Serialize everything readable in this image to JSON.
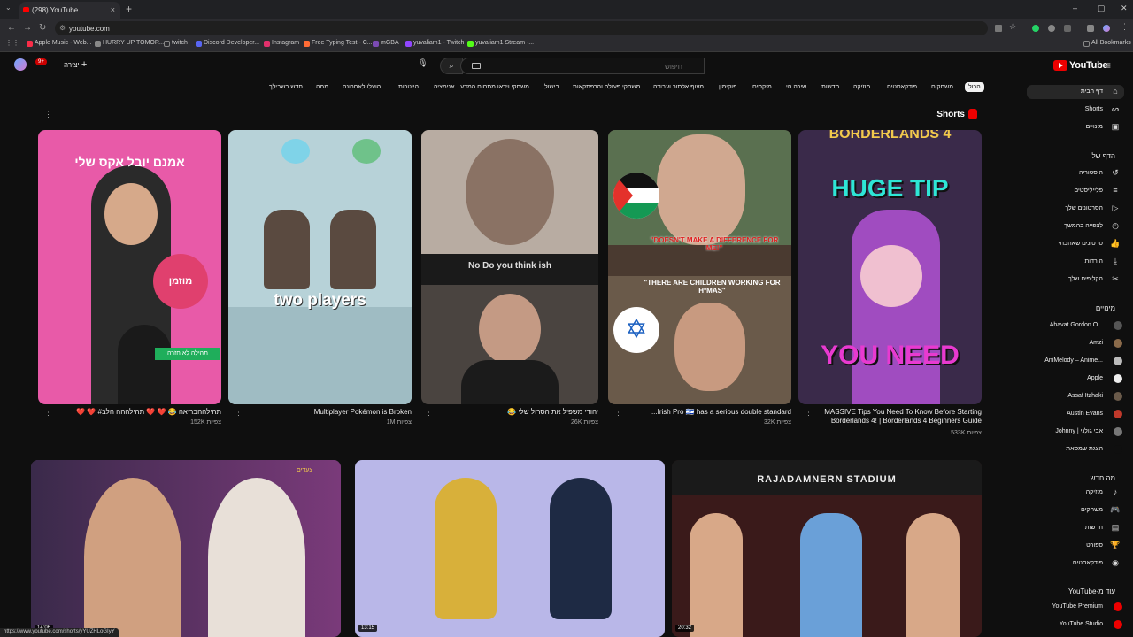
{
  "browser": {
    "tab_title": "(298) YouTube",
    "url": "youtube.com",
    "bookmarks": [
      {
        "label": "Apple Music - Web...",
        "color": "#fa2d48"
      },
      {
        "label": "HURRY UP TOMOR...",
        "color": "#888888"
      },
      {
        "label": "twitch",
        "color": "#777777"
      },
      {
        "label": "Discord Developer...",
        "color": "#5865f2"
      },
      {
        "label": "Instagram",
        "color": "#e1306c"
      },
      {
        "label": "Free Typing Test - C...",
        "color": "#ff6b35"
      },
      {
        "label": "mGBA",
        "color": "#7b4bb3"
      },
      {
        "label": "yuvaliam1 - Twitch",
        "color": "#9146ff"
      },
      {
        "label": "yuvaliam1 Stream -...",
        "color": "#53fc18"
      }
    ],
    "all_bookmarks": "All Bookmarks",
    "status_url": "https://www.youtube.com/shorts/yYUZHLoGIyY"
  },
  "header": {
    "logo": "YouTube",
    "search_placeholder": "חיפוש",
    "create_label": "יצירה",
    "notifications_count": "9+"
  },
  "chips": [
    "הכול",
    "משחקים",
    "פודקאסטים",
    "מוזיקה",
    "חדשות",
    "שירה חי",
    "מיקסים",
    "פוקימון",
    "מעוף אלתור ועבודה",
    "משחקי פעולה והרפתקאות",
    "בישול",
    "משחקי וידאו מתחום המדע",
    "אנימציה",
    "הייטרות",
    "הועלו לאחרונה",
    "ממה",
    "חדש בשבילך"
  ],
  "sidebar": {
    "main": [
      {
        "label": "דף הבית",
        "icon": "home-icon",
        "glyph": "⌂"
      },
      {
        "label": "Shorts",
        "icon": "shorts-icon",
        "glyph": "ᔕ"
      },
      {
        "label": "מינויים",
        "icon": "subscriptions-icon",
        "glyph": "▣"
      }
    ],
    "you_head": "הדף שלי",
    "you": [
      {
        "label": "היסטוריה",
        "icon": "history-icon",
        "glyph": "↺"
      },
      {
        "label": "פלייליסטים",
        "icon": "playlists-icon",
        "glyph": "≡"
      },
      {
        "label": "הסרטונים שלך",
        "icon": "your-videos-icon",
        "glyph": "▷"
      },
      {
        "label": "לצפייה בהמשך",
        "icon": "watch-later-icon",
        "glyph": "◷"
      },
      {
        "label": "סרטונים שאהבתי",
        "icon": "liked-icon",
        "glyph": "👍"
      },
      {
        "label": "הורדות",
        "icon": "downloads-icon",
        "glyph": "⤓"
      },
      {
        "label": "הקליפים שלך",
        "icon": "clips-icon",
        "glyph": "✂"
      }
    ],
    "subs_head": "מינויים",
    "subs": [
      {
        "label": "Ahavat Gordon O...",
        "color": "#555"
      },
      {
        "label": "Amzi",
        "color": "#8a6a4a"
      },
      {
        "label": "AniMelody – Anime...",
        "color": "#bbb"
      },
      {
        "label": "Apple",
        "color": "#eee"
      },
      {
        "label": "Assaf Itzhaki",
        "color": "#6a5a4a"
      },
      {
        "label": "Austin Evans",
        "color": "#c0392b"
      },
      {
        "label": "Johnny | אבי גולני",
        "color": "#777"
      },
      {
        "label": "הצגת שמסאת",
        "color": "#0f0f0f"
      }
    ],
    "explore_head": "מה חדש",
    "explore": [
      {
        "label": "מוזיקה",
        "icon": "music-icon",
        "glyph": "♪"
      },
      {
        "label": "משחקים",
        "icon": "gaming-icon",
        "glyph": "🎮"
      },
      {
        "label": "חדשות",
        "icon": "news-icon",
        "glyph": "▤"
      },
      {
        "label": "ספורט",
        "icon": "trophy-icon",
        "glyph": "🏆"
      },
      {
        "label": "פודקאסטים",
        "icon": "podcasts-icon",
        "glyph": "◉"
      }
    ],
    "more_head": "YouTube-עוד מ",
    "more": [
      {
        "label": "YouTube Premium",
        "color": "#e00"
      },
      {
        "label": "YouTube Studio",
        "color": "#e00"
      }
    ]
  },
  "shorts": {
    "title": "Shorts",
    "items": [
      {
        "title": "❤️ ❤️ #תהילההבריאה 😂 ❤️ ❤️ תהילההה הלב",
        "views": "152K צפיות",
        "overlay": "אמנם יובל אקס שלי",
        "overlay2": "מוזמן",
        "overlay3": "תהילה לא חזרה"
      },
      {
        "title": "Multiplayer Pokémon is Broken",
        "views": "1M צפיות",
        "overlay": "two players"
      },
      {
        "title": "😂 יהודי משפיל את הסרול שלי",
        "views": "26K צפיות",
        "overlay": "No Do you think ish"
      },
      {
        "title": "...Irish Pro 🇮🇱 has a serious double standard",
        "views": "32K צפיות",
        "overlay": "\"DOESN'T MAKE A DIFFERENCE FOR ME!\"",
        "overlay2": "\"THERE ARE CHILDREN WORKING FOR H*MAS\""
      },
      {
        "title": "MASSIVE Tips You Need To Know Before Starting Borderlands 4! | Borderlands 4 Beginners Guide",
        "views": "533K צפיות",
        "overlay": "HUGE TIP",
        "overlay2": "YOU NEED",
        "overlay3": "BORDERLANDS 4"
      }
    ]
  },
  "videos": [
    {
      "duration": "14:06",
      "channel_badge": "צעדים"
    },
    {
      "duration": "13:15"
    },
    {
      "duration": "20:32",
      "overlay": "RAJADAMNERN STADIUM"
    }
  ]
}
